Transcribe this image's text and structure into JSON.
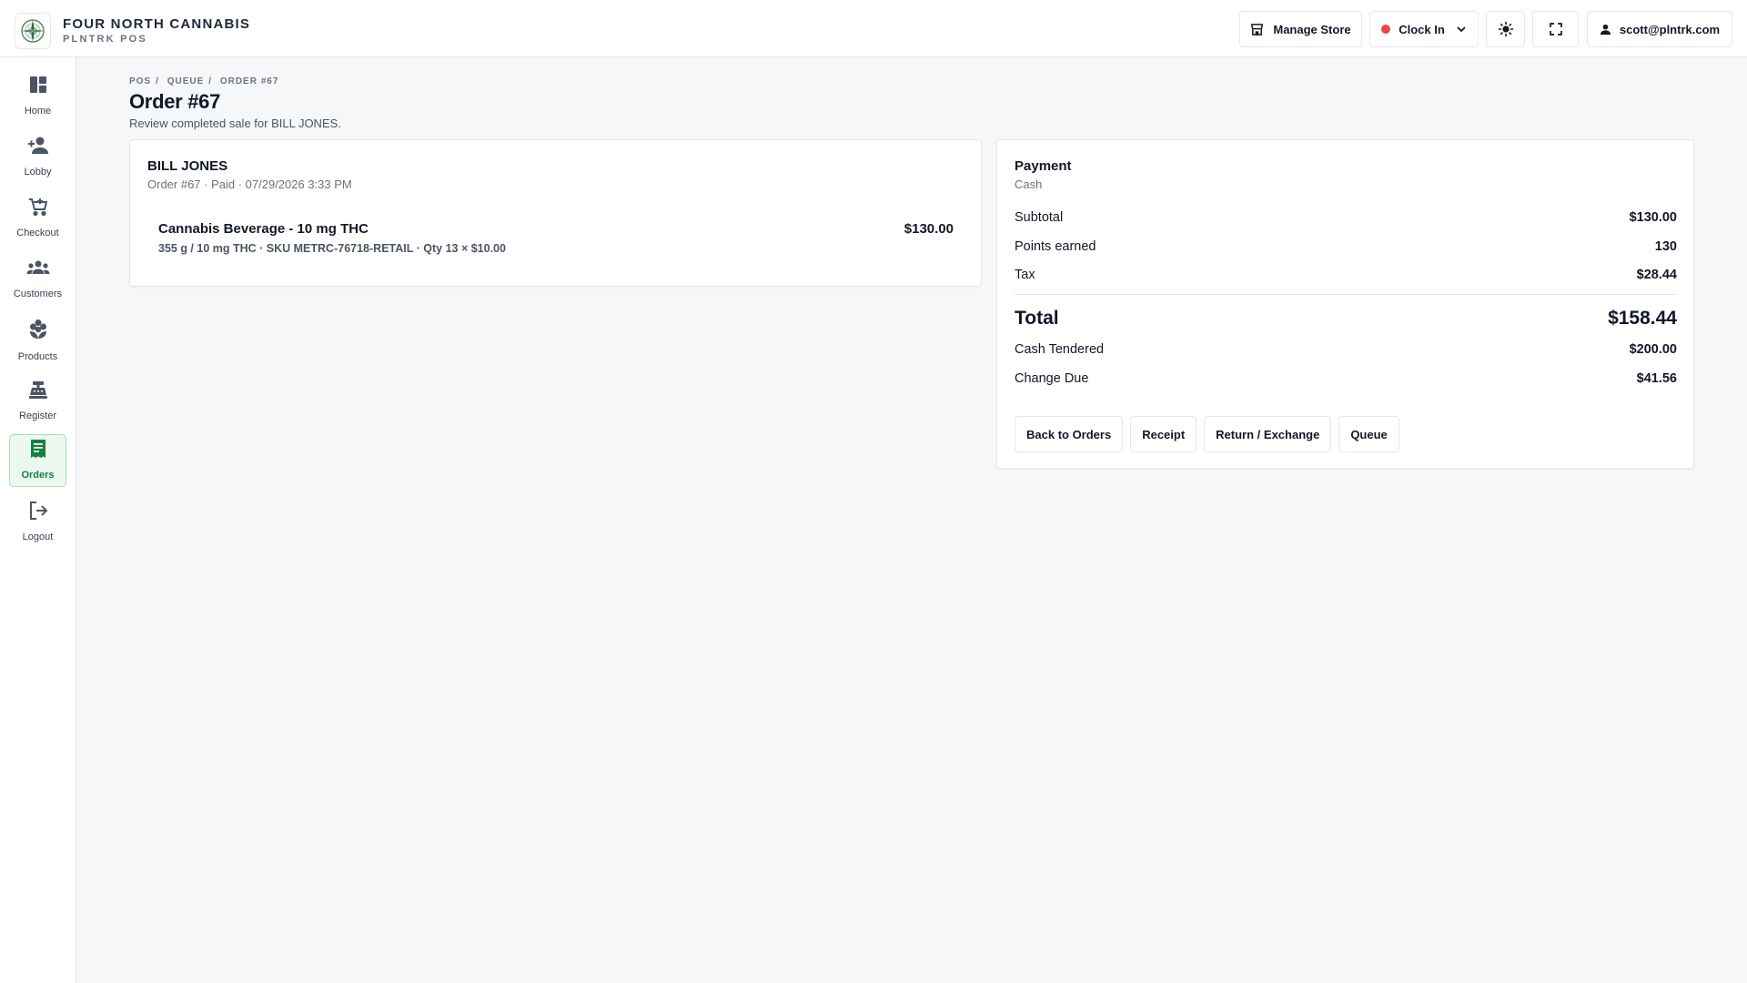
{
  "header": {
    "brand_name": "FOUR NORTH CANNABIS",
    "brand_sub": "PLNTRK POS",
    "manage_store_label": "Manage Store",
    "clock_in_label": "Clock In",
    "user_email": "scott@plntrk.com"
  },
  "sidebar": {
    "items": [
      {
        "label": "Home",
        "icon": "dashboard-icon",
        "active": false
      },
      {
        "label": "Lobby",
        "icon": "person-add-icon",
        "active": false
      },
      {
        "label": "Checkout",
        "icon": "cart-icon",
        "active": false
      },
      {
        "label": "Customers",
        "icon": "group-icon",
        "active": false
      },
      {
        "label": "Products",
        "icon": "flower-icon",
        "active": false
      },
      {
        "label": "Register",
        "icon": "register-icon",
        "active": false
      },
      {
        "label": "Orders",
        "icon": "receipt-icon",
        "active": true
      },
      {
        "label": "Logout",
        "icon": "logout-icon",
        "active": false
      }
    ]
  },
  "breadcrumb": [
    "POS",
    "QUEUE",
    "ORDER #67"
  ],
  "page": {
    "title": "Order #67",
    "subtitle": "Review completed sale for BILL JONES."
  },
  "order": {
    "customer_name": "BILL JONES",
    "meta": "Order #67 · Paid · 07/29/2026 3:33 PM",
    "items": [
      {
        "name": "Cannabis Beverage - 10 mg THC",
        "detail": "355 g / 10 mg THC · SKU METRC-76718-RETAIL · Qty 13 × $10.00",
        "price": "$130.00"
      }
    ]
  },
  "payment": {
    "title": "Payment",
    "method": "Cash",
    "subtotal_label": "Subtotal",
    "subtotal": "$130.00",
    "points_label": "Points earned",
    "points": "130",
    "tax_label": "Tax",
    "tax": "$28.44",
    "total_label": "Total",
    "total": "$158.44",
    "tendered_label": "Cash Tendered",
    "tendered": "$200.00",
    "change_label": "Change Due",
    "change": "$41.56"
  },
  "actions": {
    "back": "Back to Orders",
    "receipt": "Receipt",
    "return": "Return / Exchange",
    "queue": "Queue"
  },
  "colors": {
    "accent": "#15803d",
    "active_bg": "#ecf8ef",
    "clock_dot": "#ef4444"
  }
}
